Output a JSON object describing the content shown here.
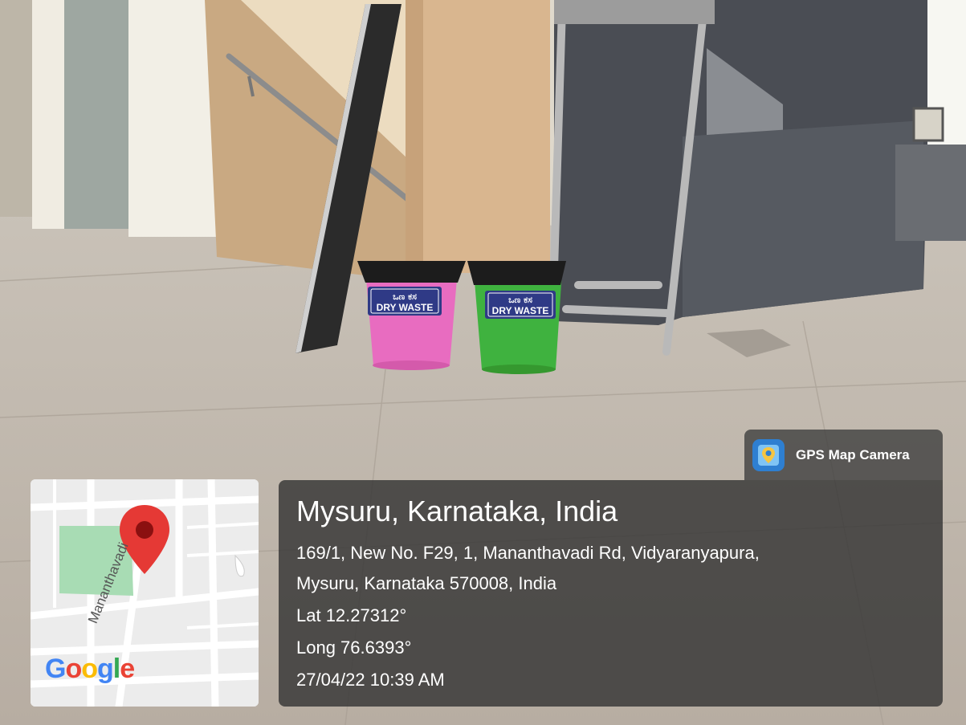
{
  "photo": {
    "bins": [
      {
        "color": "#e86cc0",
        "label_kn": "ಒಣ ಕಸ",
        "label_en": "DRY WASTE"
      },
      {
        "color": "#3fb23f",
        "label_kn": "ಒಣ ಕಸ",
        "label_en": "DRY WASTE"
      }
    ]
  },
  "overlay": {
    "app_icon": "gps-map-camera-icon",
    "app_name": "GPS Map Camera",
    "place": "Mysuru, Karnataka, India",
    "address_line1": "169/1, New No. F29, 1, Mananthavadi Rd, Vidyaranyapura,",
    "address_line2": "Mysuru, Karnataka 570008, India",
    "lat": "Lat 12.27312°",
    "long": "Long 76.6393°",
    "datetime": "27/04/22 10:39 AM"
  },
  "map": {
    "road_label": "Mananthavadi",
    "logo": "Google",
    "pin_icon": "map-pin-icon",
    "pin_color": "#e53935",
    "park_color": "#a8dcb4"
  }
}
